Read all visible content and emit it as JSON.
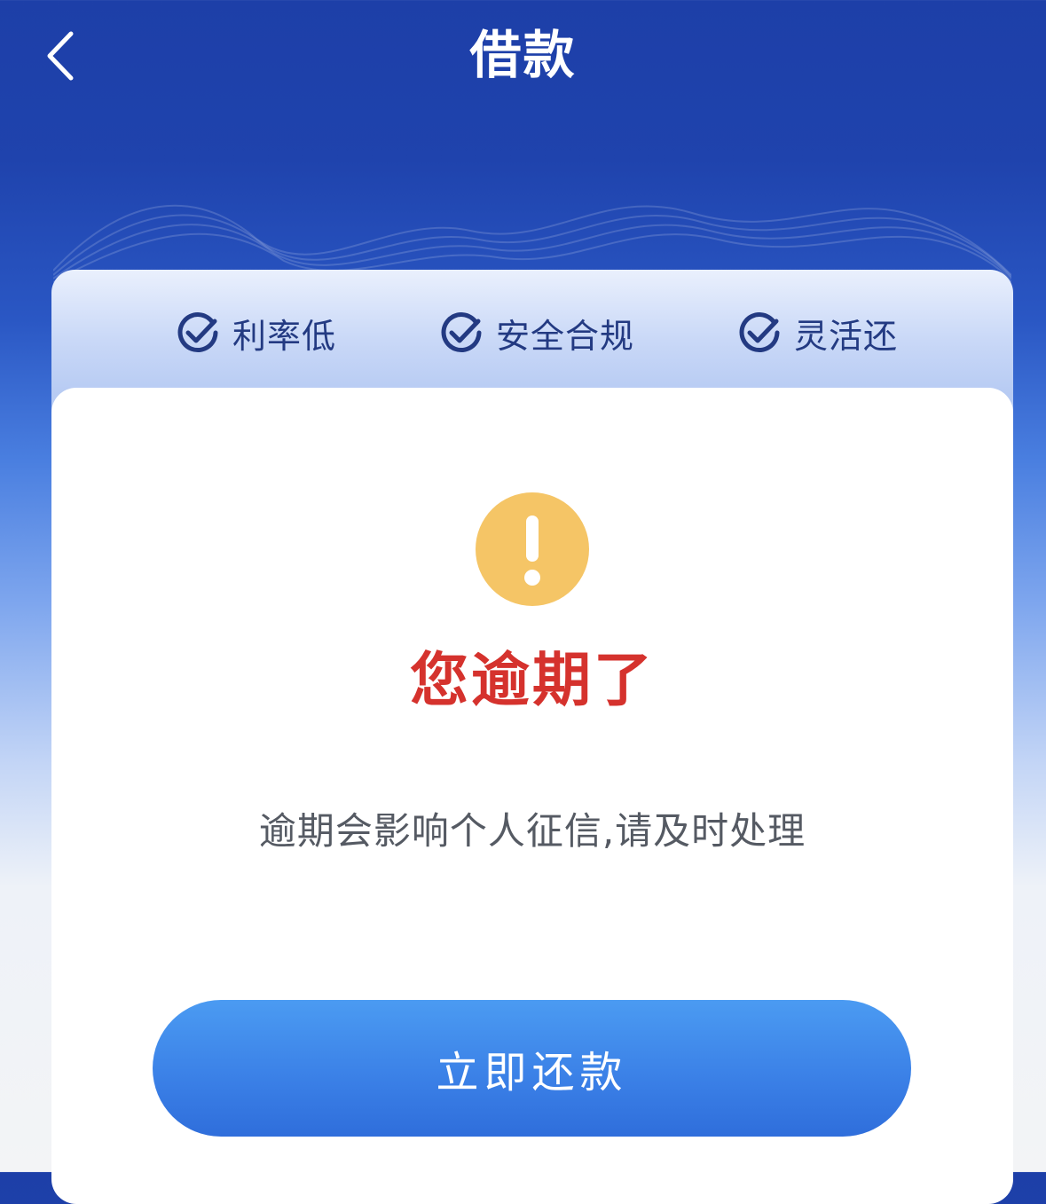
{
  "header": {
    "title": "借款",
    "back_icon": "chevron-left-icon"
  },
  "benefits": [
    {
      "label": "利率低",
      "icon": "check-circle-icon"
    },
    {
      "label": "安全合规",
      "icon": "check-circle-icon"
    },
    {
      "label": "灵活还",
      "icon": "check-circle-icon"
    }
  ],
  "alert": {
    "icon": "exclamation-circle-icon",
    "title": "您逾期了",
    "message": "逾期会影响个人征信,请及时处理"
  },
  "actions": {
    "repay_label": "立即还款"
  },
  "colors": {
    "header_blue": "#1d3fa8",
    "benefit_text": "#233a82",
    "alert_red": "#d5322d",
    "warning_yellow": "#f5c566",
    "button_blue": "#3a7fe6"
  }
}
